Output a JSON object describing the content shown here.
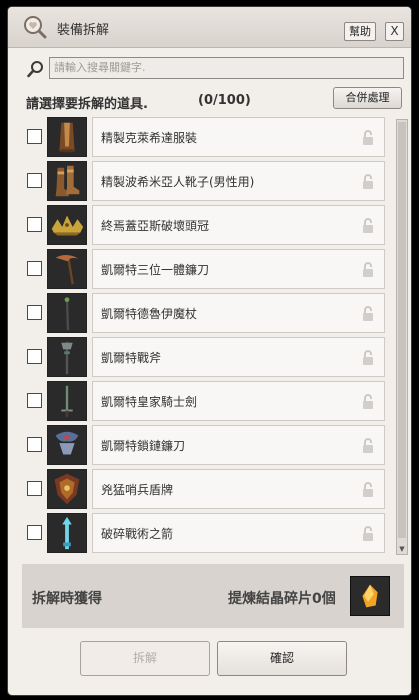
{
  "window": {
    "title": "裝備拆解",
    "help_label": "幫助",
    "close_label": "X",
    "title_icon": "magnifier-heart-icon"
  },
  "search": {
    "placeholder": "請輸入搜尋關鍵字.",
    "icon": "search-icon"
  },
  "selection": {
    "prompt": "請選擇要拆解的道具.",
    "count": "(0/100)",
    "merge_label": "合併處理"
  },
  "items": [
    {
      "name": "精製克萊希達服裝",
      "icon": "robe-icon"
    },
    {
      "name": "精製波希米亞人靴子(男性用)",
      "icon": "boots-icon"
    },
    {
      "name": "終焉蓋亞斯破壞頭冠",
      "icon": "crown-icon"
    },
    {
      "name": "凱爾特三位一體鐮刀",
      "icon": "scythe-icon"
    },
    {
      "name": "凱爾特德魯伊魔杖",
      "icon": "staff-icon"
    },
    {
      "name": "凱爾特戰斧",
      "icon": "axe-icon"
    },
    {
      "name": "凱爾特皇家騎士劍",
      "icon": "sword-icon"
    },
    {
      "name": "凱爾特鎖鏈鐮刀",
      "icon": "chain-scythe-icon"
    },
    {
      "name": "兇猛哨兵盾牌",
      "icon": "shield-icon"
    },
    {
      "name": "破碎戰術之箭",
      "icon": "arrow-icon"
    }
  ],
  "result": {
    "label": "拆解時獲得",
    "value": "提煉結晶碎片0個",
    "icon": "crystal-shard-icon"
  },
  "buttons": {
    "disassemble": "拆解",
    "confirm": "確認"
  },
  "colors": {
    "window_bg": "#f2eeea",
    "panel_bg": "#d8d3cf",
    "text": "#333333",
    "disabled_text": "#b4aea8"
  }
}
